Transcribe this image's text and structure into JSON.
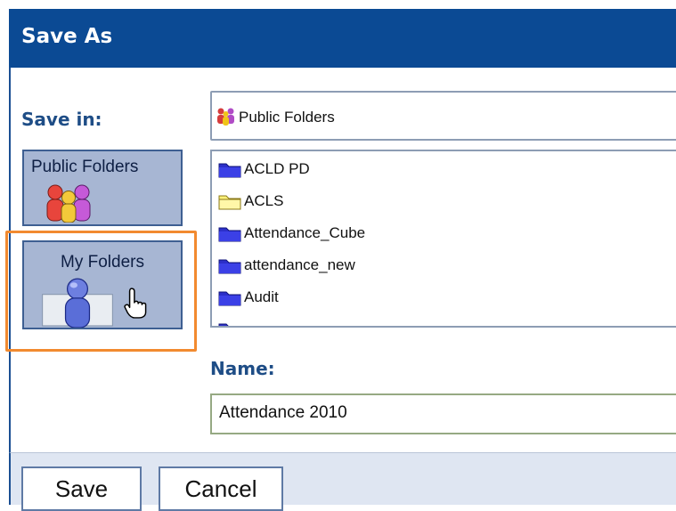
{
  "dialog": {
    "title": "Save As"
  },
  "save_in": {
    "label": "Save in:",
    "current_path": "Public Folders"
  },
  "places": [
    {
      "label": "Public Folders",
      "icon": "group-folder-icon"
    },
    {
      "label": "My Folders",
      "icon": "my-folder-user-icon"
    }
  ],
  "folders": [
    {
      "label": "ACLD PD",
      "icon": "blue-folder-icon"
    },
    {
      "label": "ACLS",
      "icon": "yellow-folder-icon"
    },
    {
      "label": "Attendance_Cube",
      "icon": "blue-folder-icon"
    },
    {
      "label": "attendance_new",
      "icon": "blue-folder-icon"
    },
    {
      "label": "Audit",
      "icon": "blue-folder-icon"
    },
    {
      "label": "",
      "icon": "blue-folder-icon"
    }
  ],
  "name": {
    "label": "Name:",
    "value": "Attendance 2010"
  },
  "buttons": {
    "save": "Save",
    "cancel": "Cancel"
  },
  "colors": {
    "title_bar": "#0b4a94",
    "label_text": "#1e4d86",
    "highlight": "#f28a2f",
    "place_button": "#a7b6d3"
  }
}
